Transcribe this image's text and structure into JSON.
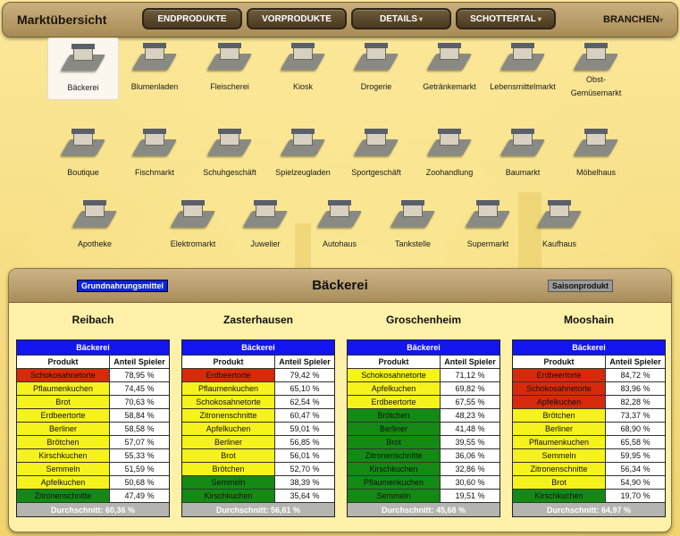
{
  "title": "Marktübersicht",
  "nav": {
    "endprodukte": "ENDPRODUKTE",
    "vorprodukte": "VORPRODUKTE",
    "details": "DETAILS",
    "schottertal": "SCHOTTERTAL",
    "branchen": "BRANCHEN"
  },
  "shops": [
    {
      "label": "Bäckerei",
      "icon": "bakery-building-icon"
    },
    {
      "label": "Blumenladen",
      "icon": "flower-shop-building-icon"
    },
    {
      "label": "Fleischerei",
      "icon": "butcher-building-icon"
    },
    {
      "label": "Kiosk",
      "icon": "kiosk-building-icon"
    },
    {
      "label": "Drogerie",
      "icon": "drugstore-building-icon"
    },
    {
      "label": "Getränkemarkt",
      "icon": "beverage-store-building-icon"
    },
    {
      "label": "Lebensmittelmarkt",
      "icon": "grocery-building-icon"
    },
    {
      "label": "Obst-\nGemüsemarkt",
      "icon": "greengrocer-building-icon"
    },
    {
      "label": "Boutique",
      "icon": "boutique-building-icon"
    },
    {
      "label": "Fischmarkt",
      "icon": "fish-market-building-icon"
    },
    {
      "label": "Schuhgeschäft",
      "icon": "shoe-store-building-icon"
    },
    {
      "label": "Spielzeugladen",
      "icon": "toy-store-building-icon"
    },
    {
      "label": "Sportgeschäft",
      "icon": "sports-store-building-icon"
    },
    {
      "label": "Zoohandlung",
      "icon": "pet-shop-building-icon"
    },
    {
      "label": "Baumarkt",
      "icon": "hardware-store-building-icon"
    },
    {
      "label": "Möbelhaus",
      "icon": "furniture-store-building-icon"
    },
    {
      "label": "Apotheke",
      "icon": "pharmacy-building-icon"
    },
    {
      "label": "Elektromarkt",
      "icon": "electronics-store-building-icon"
    },
    {
      "label": "Juwelier",
      "icon": "jeweler-building-icon"
    },
    {
      "label": "Autohaus",
      "icon": "car-dealer-building-icon"
    },
    {
      "label": "Tankstelle",
      "icon": "gas-station-building-icon"
    },
    {
      "label": "Supermarkt",
      "icon": "supermarket-building-icon"
    },
    {
      "label": "Kaufhaus",
      "icon": "department-store-building-icon"
    }
  ],
  "panel": {
    "title": "Bäckerei",
    "tag_left": "Grundnahrungsmittel",
    "tag_right": "Saisonprodukt"
  },
  "colors": {
    "red": "#d62a0a",
    "yellow": "#f6f21c",
    "green": "#148a14",
    "blue": "#1414f0"
  },
  "markets": [
    {
      "city": "Reibach",
      "caption": "Bäckerei",
      "col_product": "Produkt",
      "col_share": "Anteil Spieler",
      "rows": [
        {
          "product": "Schokosahnetorte",
          "share": "78,95 %",
          "color": "red"
        },
        {
          "product": "Pflaumenkuchen",
          "share": "74,45 %",
          "color": "yellow"
        },
        {
          "product": "Brot",
          "share": "70,63 %",
          "color": "yellow"
        },
        {
          "product": "Erdbeertorte",
          "share": "58,84 %",
          "color": "yellow"
        },
        {
          "product": "Berliner",
          "share": "58,58 %",
          "color": "yellow"
        },
        {
          "product": "Brötchen",
          "share": "57,07 %",
          "color": "yellow"
        },
        {
          "product": "Kirschkuchen",
          "share": "55,33 %",
          "color": "yellow"
        },
        {
          "product": "Semmeln",
          "share": "51,59 %",
          "color": "yellow"
        },
        {
          "product": "Apfelkuchen",
          "share": "50,68 %",
          "color": "yellow"
        },
        {
          "product": "Zitronenschnitte",
          "share": "47,49 %",
          "color": "green"
        }
      ],
      "average": "Durchschnitt: 60,36 %"
    },
    {
      "city": "Zasterhausen",
      "caption": "Bäckerei",
      "col_product": "Produkt",
      "col_share": "Anteil Spieler",
      "rows": [
        {
          "product": "Erdbeertorte",
          "share": "79,42 %",
          "color": "red"
        },
        {
          "product": "Pflaumenkuchen",
          "share": "65,10 %",
          "color": "yellow"
        },
        {
          "product": "Schokosahnetorte",
          "share": "62,54 %",
          "color": "yellow"
        },
        {
          "product": "Zitronenschnitte",
          "share": "60,47 %",
          "color": "yellow"
        },
        {
          "product": "Apfelkuchen",
          "share": "59,01 %",
          "color": "yellow"
        },
        {
          "product": "Berliner",
          "share": "56,85 %",
          "color": "yellow"
        },
        {
          "product": "Brot",
          "share": "56,01 %",
          "color": "yellow"
        },
        {
          "product": "Brötchen",
          "share": "52,70 %",
          "color": "yellow"
        },
        {
          "product": "Semmeln",
          "share": "38,39 %",
          "color": "green"
        },
        {
          "product": "Kirschkuchen",
          "share": "35,64 %",
          "color": "green"
        }
      ],
      "average": "Durchschnitt: 56,61 %"
    },
    {
      "city": "Groschenheim",
      "caption": "Bäckerei",
      "col_product": "Produkt",
      "col_share": "Anteil Spieler",
      "rows": [
        {
          "product": "Schokosahnetorte",
          "share": "71,12 %",
          "color": "yellow"
        },
        {
          "product": "Apfelkuchen",
          "share": "69,82 %",
          "color": "yellow"
        },
        {
          "product": "Erdbeertorte",
          "share": "67,55 %",
          "color": "yellow"
        },
        {
          "product": "Brötchen",
          "share": "48,23 %",
          "color": "green"
        },
        {
          "product": "Berliner",
          "share": "41,48 %",
          "color": "green"
        },
        {
          "product": "Brot",
          "share": "39,55 %",
          "color": "green"
        },
        {
          "product": "Zitronenschnitte",
          "share": "36,06 %",
          "color": "green"
        },
        {
          "product": "Kirschkuchen",
          "share": "32,86 %",
          "color": "green"
        },
        {
          "product": "Pflaumenkuchen",
          "share": "30,60 %",
          "color": "green"
        },
        {
          "product": "Semmeln",
          "share": "19,51 %",
          "color": "green"
        }
      ],
      "average": "Durchschnitt: 45,68 %"
    },
    {
      "city": "Mooshain",
      "caption": "Bäckerei",
      "col_product": "Produkt",
      "col_share": "Anteil Spieler",
      "rows": [
        {
          "product": "Erdbeertorte",
          "share": "84,72 %",
          "color": "red"
        },
        {
          "product": "Schokosahnetorte",
          "share": "83,96 %",
          "color": "red"
        },
        {
          "product": "Apfelkuchen",
          "share": "82,28 %",
          "color": "red"
        },
        {
          "product": "Brötchen",
          "share": "73,37 %",
          "color": "yellow"
        },
        {
          "product": "Berliner",
          "share": "68,90 %",
          "color": "yellow"
        },
        {
          "product": "Pflaumenkuchen",
          "share": "65,58 %",
          "color": "yellow"
        },
        {
          "product": "Semmeln",
          "share": "59,95 %",
          "color": "yellow"
        },
        {
          "product": "Zitronenschnitte",
          "share": "56,34 %",
          "color": "yellow"
        },
        {
          "product": "Brot",
          "share": "54,90 %",
          "color": "yellow"
        },
        {
          "product": "Kirschkuchen",
          "share": "19,70 %",
          "color": "green"
        }
      ],
      "average": "Durchschnitt: 64,97 %"
    }
  ]
}
